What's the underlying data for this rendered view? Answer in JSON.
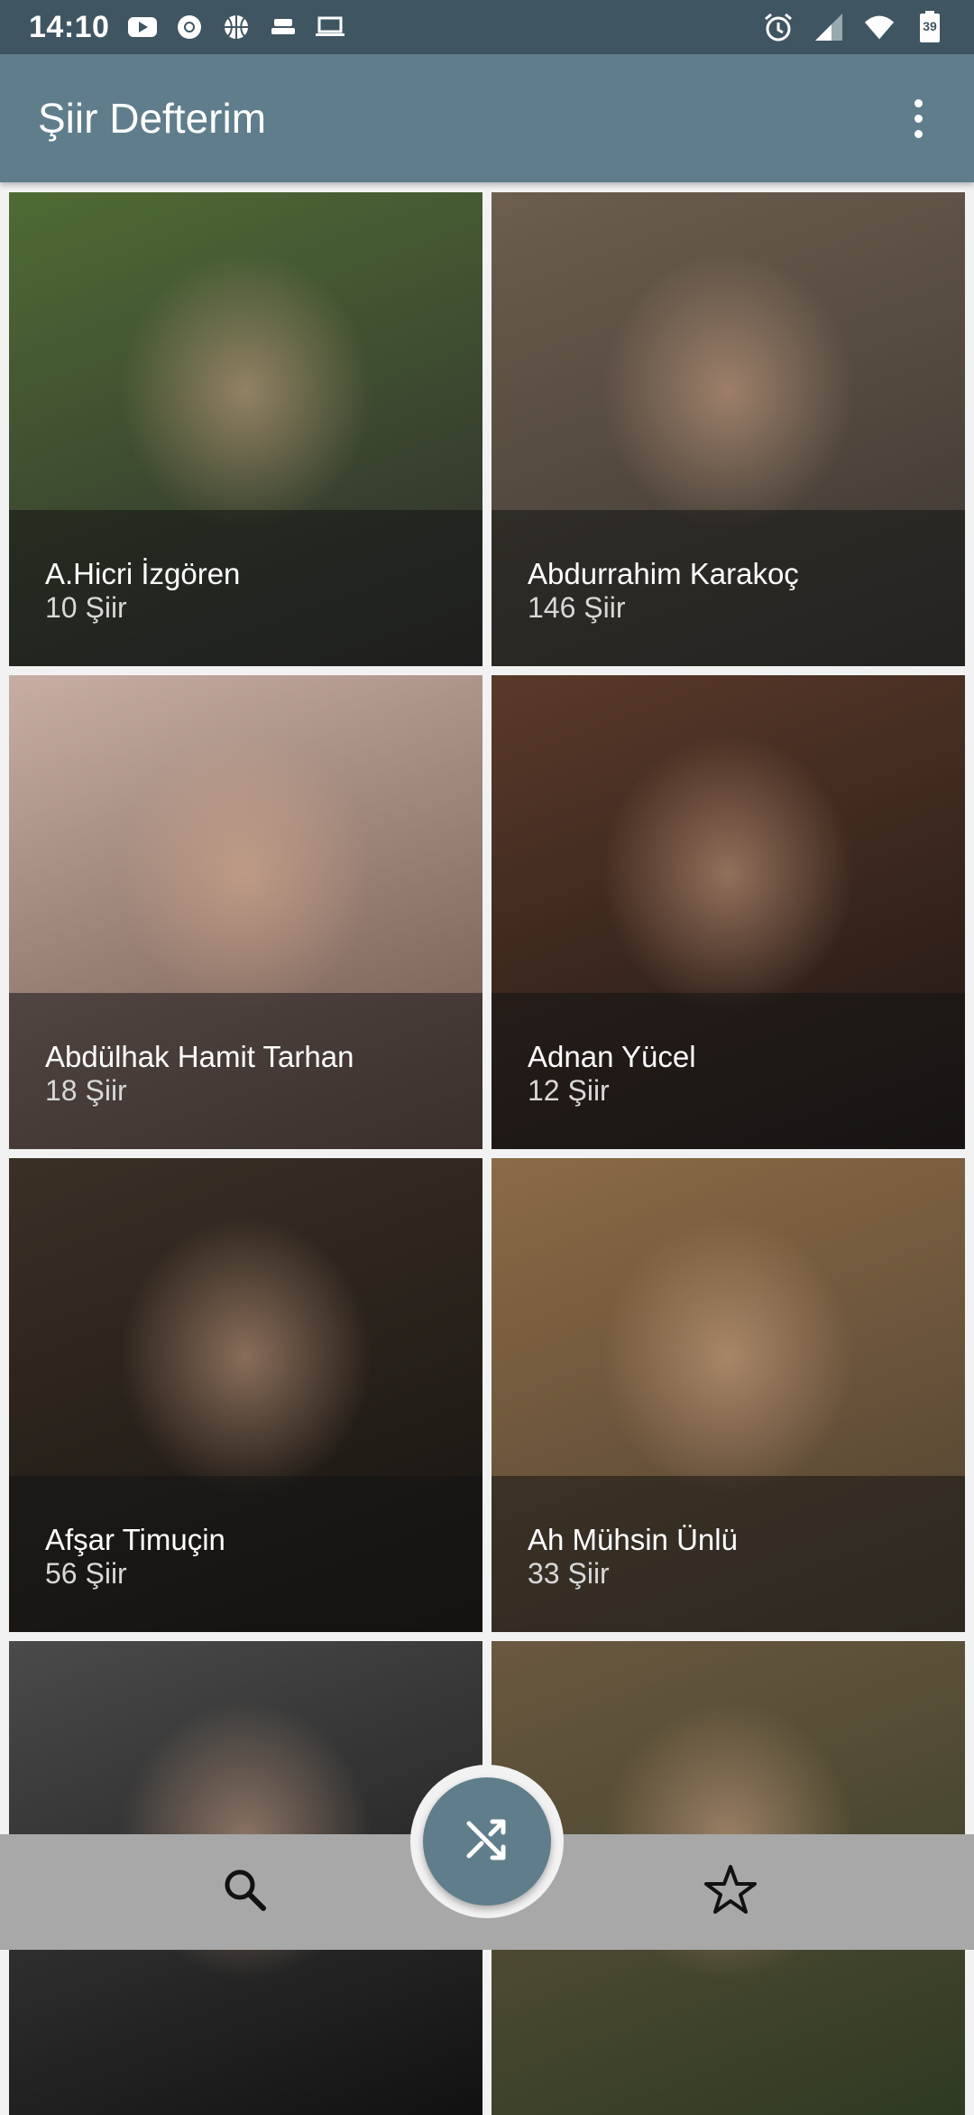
{
  "status_bar": {
    "time": "14:10",
    "battery_level": "39",
    "left_icons": [
      "youtube-icon",
      "chrome-icon",
      "basketball-icon",
      "cast-icon",
      "laptop-icon"
    ],
    "right_icons": [
      "alarm-icon",
      "signal-icon",
      "wifi-icon",
      "battery-icon"
    ]
  },
  "app_bar": {
    "title": "Şiir Defterim",
    "menu_icon": "more-vert-icon"
  },
  "poets": [
    {
      "name": "A.Hicri İzgören",
      "count": "10 Şiir",
      "photo_colors": [
        "#4f6b34",
        "#2c2c2c"
      ]
    },
    {
      "name": "Abdurrahim Karakoç",
      "count": "146 Şiir",
      "photo_colors": [
        "#6d5e4e",
        "#3a3530"
      ]
    },
    {
      "name": "Abdülhak Hamit Tarhan",
      "count": "18 Şiir",
      "photo_colors": [
        "#c7aea2",
        "#6a5248"
      ]
    },
    {
      "name": "Adnan Yücel",
      "count": "12 Şiir",
      "photo_colors": [
        "#5a3a2a",
        "#1d1512"
      ]
    },
    {
      "name": "Afşar Timuçin",
      "count": "56 Şiir",
      "photo_colors": [
        "#3b3026",
        "#15120f"
      ]
    },
    {
      "name": "Ah Mühsin Ünlü",
      "count": "33 Şiir",
      "photo_colors": [
        "#8c6a46",
        "#4c4130"
      ]
    },
    {
      "name": "",
      "count": "",
      "photo_colors": [
        "#4a4a4a",
        "#111111"
      ]
    },
    {
      "name": "",
      "count": "",
      "photo_colors": [
        "#6b5840",
        "#2e3a22"
      ]
    }
  ],
  "bottom_nav": {
    "search_icon": "search-icon",
    "shuffle_icon": "shuffle-icon",
    "favorites_icon": "star-icon"
  },
  "colors": {
    "status_bar": "#3f5562",
    "app_bar": "#607d8b",
    "fab": "#607d8b",
    "bottom_bar": "#a8a8a8"
  }
}
